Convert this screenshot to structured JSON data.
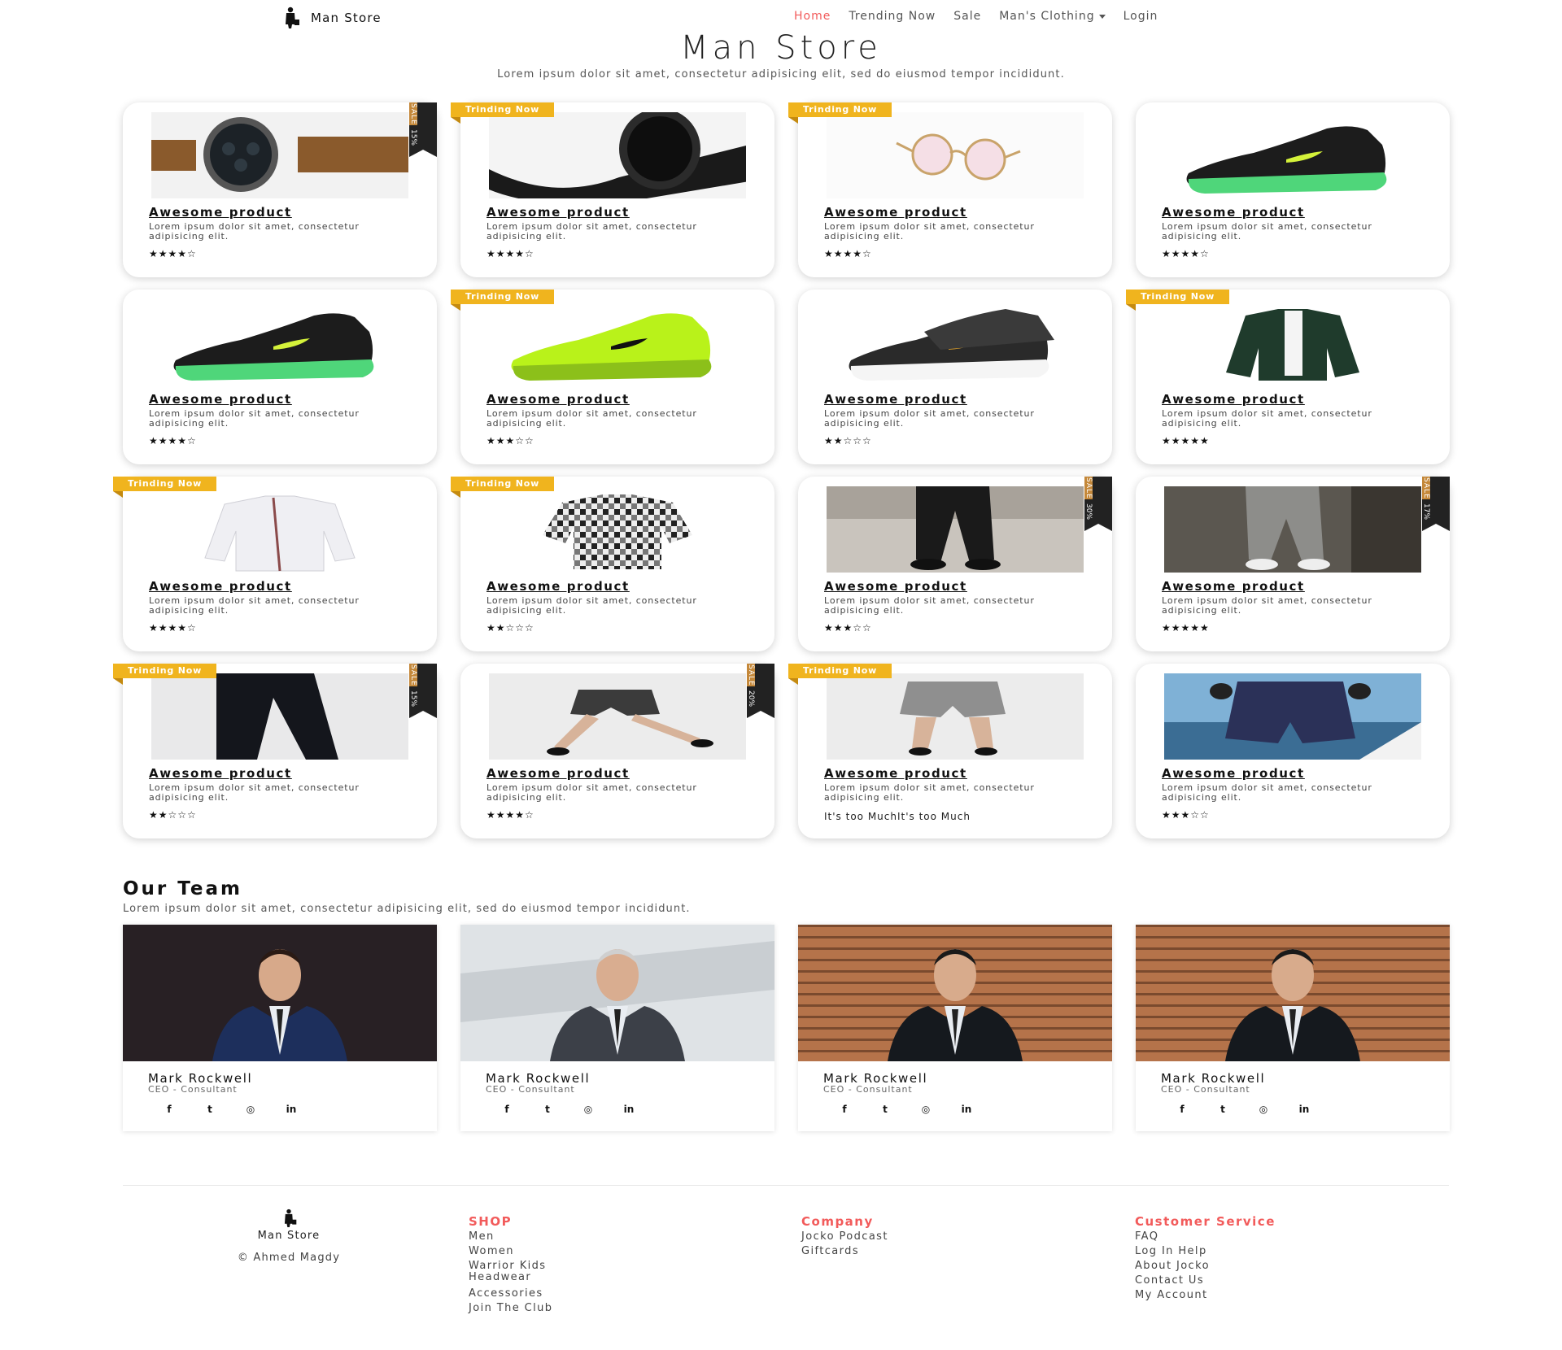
{
  "nav": {
    "brand": "Man Store",
    "links": [
      "Home",
      "Trending Now",
      "Sale",
      "Man's Clothing",
      "Login"
    ],
    "active": "Home"
  },
  "hero": {
    "title": "Man Store",
    "subtitle": "Lorem ipsum dolor sit amet, consectetur adipisicing elit, sed do eiusmod tempor incididunt."
  },
  "products": [
    {
      "title": "Awesome product",
      "desc": "Lorem ipsum dolor sit amet, consectetur adipisicing elit.",
      "stars": "★★★★☆",
      "rating": 4,
      "ribbon": "",
      "sale": "SALE",
      "sale_pct": "15%",
      "image": "watch-brown"
    },
    {
      "title": "Awesome product",
      "desc": "Lorem ipsum dolor sit amet, consectetur adipisicing elit.",
      "stars": "★★★★☆",
      "rating": 4,
      "ribbon": "Trinding Now",
      "sale": "",
      "sale_pct": "",
      "image": "watch-black"
    },
    {
      "title": "Awesome product",
      "desc": "Lorem ipsum dolor sit amet, consectetur adipisicing elit.",
      "stars": "★★★★☆",
      "rating": 4,
      "ribbon": "Trinding Now",
      "sale": "",
      "sale_pct": "",
      "image": "glasses"
    },
    {
      "title": "Awesome product",
      "desc": "Lorem ipsum dolor sit amet, consectetur adipisicing elit.",
      "stars": "★★★★☆",
      "rating": 4,
      "ribbon": "",
      "sale": "",
      "sale_pct": "",
      "image": "shoe-black-green"
    },
    {
      "title": "Awesome product",
      "desc": "Lorem ipsum dolor sit amet, consectetur adipisicing elit.",
      "stars": "★★★★☆",
      "rating": 4,
      "ribbon": "",
      "sale": "",
      "sale_pct": "",
      "image": "shoe-black-green"
    },
    {
      "title": "Awesome product",
      "desc": "Lorem ipsum dolor sit amet, consectetur adipisicing elit.",
      "stars": "★★★☆☆",
      "rating": 3,
      "ribbon": "Trinding Now",
      "sale": "",
      "sale_pct": "",
      "image": "shoe-lime"
    },
    {
      "title": "Awesome product",
      "desc": "Lorem ipsum dolor sit amet, consectetur adipisicing elit.",
      "stars": "★★☆☆☆",
      "rating": 2,
      "ribbon": "",
      "sale": "",
      "sale_pct": "",
      "image": "shoe-pair"
    },
    {
      "title": "Awesome product",
      "desc": "Lorem ipsum dolor sit amet, consectetur adipisicing elit.",
      "stars": "★★★★★",
      "rating": 5,
      "ribbon": "Trinding Now",
      "sale": "",
      "sale_pct": "",
      "image": "jacket"
    },
    {
      "title": "Awesome product",
      "desc": "Lorem ipsum dolor sit amet, consectetur adipisicing elit.",
      "stars": "★★★★☆",
      "rating": 4,
      "ribbon": "Trinding Now",
      "sale": "",
      "sale_pct": "",
      "image": "shirt-white"
    },
    {
      "title": "Awesome product",
      "desc": "Lorem ipsum dolor sit amet, consectetur adipisicing elit.",
      "stars": "★★☆☆☆",
      "rating": 2,
      "ribbon": "Trinding Now",
      "sale": "",
      "sale_pct": "",
      "image": "shirt-plaid"
    },
    {
      "title": "Awesome product",
      "desc": "Lorem ipsum dolor sit amet, consectetur adipisicing elit.",
      "stars": "★★★☆☆",
      "rating": 3,
      "ribbon": "",
      "sale": "SALE",
      "sale_pct": "30%",
      "image": "pants-street"
    },
    {
      "title": "Awesome product",
      "desc": "Lorem ipsum dolor sit amet, consectetur adipisicing elit.",
      "stars": "★★★★★",
      "rating": 5,
      "ribbon": "",
      "sale": "SALE",
      "sale_pct": "17%",
      "image": "pants-plaid"
    },
    {
      "title": "Awesome product",
      "desc": "Lorem ipsum dolor sit amet, consectetur adipisicing elit.",
      "stars": "★★☆☆☆",
      "rating": 2,
      "ribbon": "Trinding Now",
      "sale": "SALE",
      "sale_pct": "15%",
      "image": "trousers"
    },
    {
      "title": "Awesome product",
      "desc": "Lorem ipsum dolor sit amet, consectetur adipisicing elit.",
      "stars": "★★★★☆",
      "rating": 4,
      "ribbon": "",
      "sale": "SALE",
      "sale_pct": "20%",
      "image": "shorts-walk"
    },
    {
      "title": "Awesome product",
      "desc": "Lorem ipsum dolor sit amet, consectetur adipisicing elit.",
      "stars": "",
      "rating": 0,
      "note": "It's too MuchIt's too Much",
      "ribbon": "Trinding Now",
      "sale": "",
      "sale_pct": "",
      "image": "shorts-grey"
    },
    {
      "title": "Awesome product",
      "desc": "Lorem ipsum dolor sit amet, consectetur adipisicing elit.",
      "stars": "★★★☆☆",
      "rating": 3,
      "ribbon": "",
      "sale": "",
      "sale_pct": "",
      "image": "shorts-navy"
    }
  ],
  "team": {
    "title": "Our Team",
    "subtitle": "Lorem ipsum dolor sit amet, consectetur adipisicing elit, sed do eiusmod tempor incididunt.",
    "members": [
      {
        "name": "Mark Rockwell",
        "role": "CEO - Consultant",
        "photo": "blue-suit"
      },
      {
        "name": "Mark Rockwell",
        "role": "CEO - Consultant",
        "photo": "grey-suit"
      },
      {
        "name": "Mark Rockwell",
        "role": "CEO - Consultant",
        "photo": "black-suit-wall"
      },
      {
        "name": "Mark Rockwell",
        "role": "CEO - Consultant",
        "photo": "black-suit-wall"
      }
    ],
    "socials": [
      "facebook-icon",
      "twitter-icon",
      "instagram-icon",
      "linkedin-icon"
    ]
  },
  "footer": {
    "brand": "Man Store",
    "copyright": "© Ahmed Magdy",
    "columns": [
      {
        "heading": "SHOP",
        "links": [
          "Men",
          "Women",
          "Warrior Kids",
          "Headwear",
          "Accessories",
          "Join The Club"
        ]
      },
      {
        "heading": "Company",
        "links": [
          "Jocko Podcast",
          "Giftcards"
        ]
      },
      {
        "heading": "Customer Service",
        "links": [
          "FAQ",
          "Log In Help",
          "About Jocko",
          "Contact Us",
          "My Account"
        ]
      }
    ]
  },
  "colors": {
    "accent": "#f25b5b",
    "ribbon": "#f0b41e",
    "sale": "#c4883a",
    "dark": "#222222"
  }
}
